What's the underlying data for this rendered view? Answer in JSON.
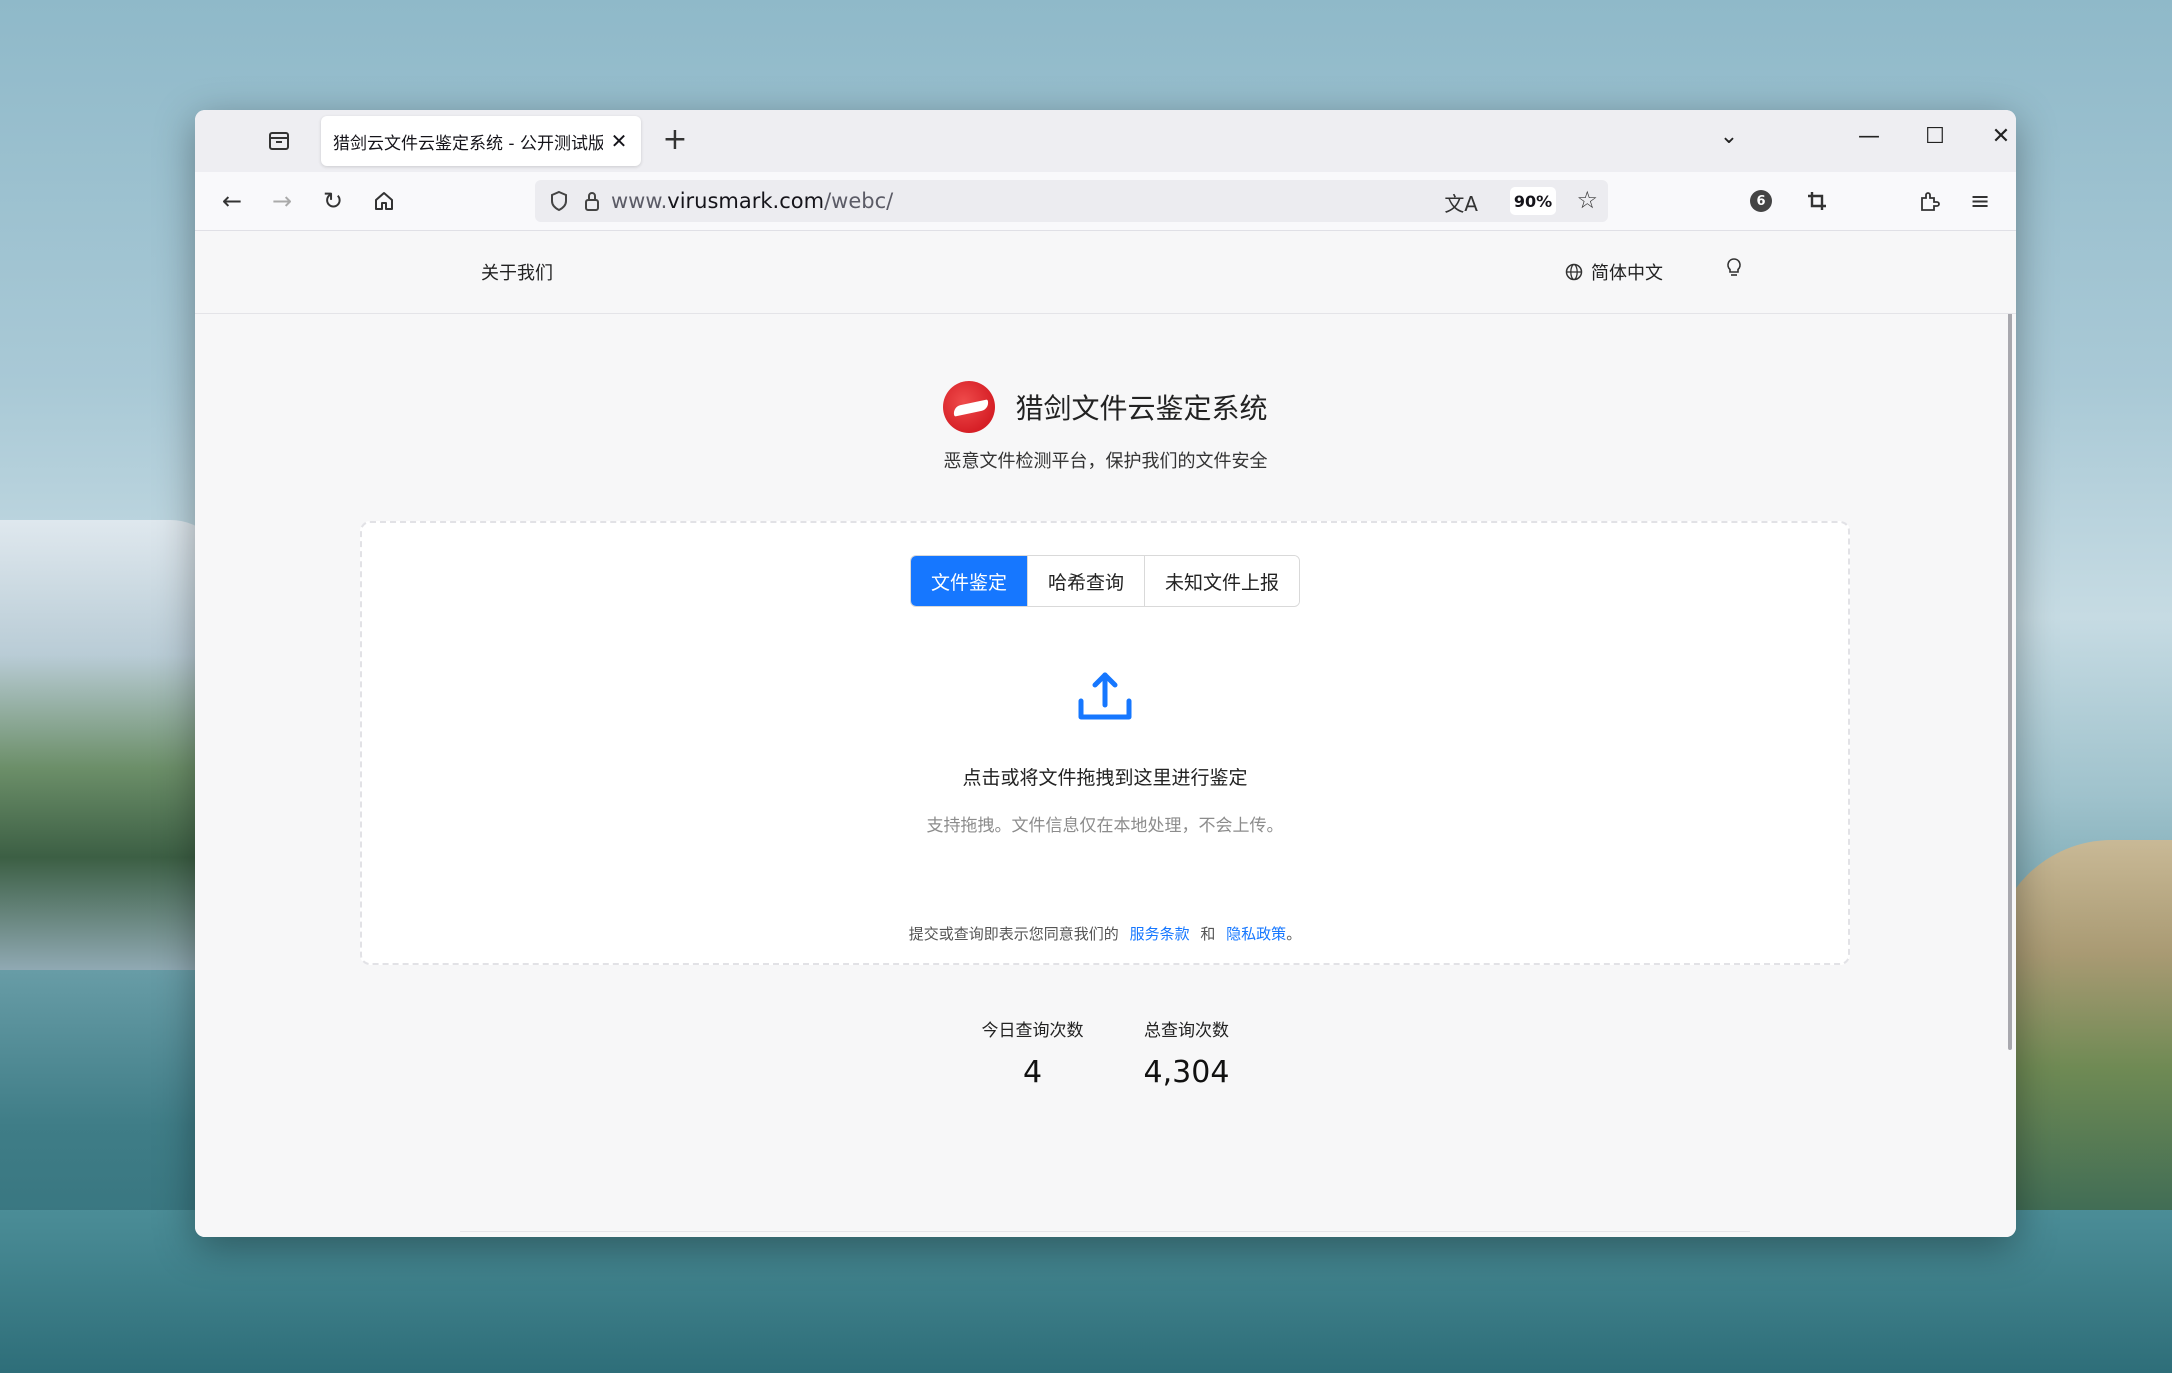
{
  "tab": {
    "title": "猎剑云文件云鉴定系统 - 公开测试版"
  },
  "urlbar": {
    "url_prefix": "www.",
    "url_domain": "virusmark.com",
    "url_path": "/webc/",
    "zoom": "90%"
  },
  "toolbar": {
    "extension_badge": "6"
  },
  "header": {
    "about": "关于我们",
    "language": "简体中文"
  },
  "brand": {
    "title": "猎剑文件云鉴定系统",
    "subtitle": "恶意文件检测平台，保护我们的文件安全"
  },
  "tabs": [
    {
      "label": "文件鉴定",
      "active": true
    },
    {
      "label": "哈希查询",
      "active": false
    },
    {
      "label": "未知文件上报",
      "active": false
    }
  ],
  "upload": {
    "main_text": "点击或将文件拖拽到这里进行鉴定",
    "hint_text": "支持拖拽。文件信息仅在本地处理，不会上传。"
  },
  "terms": {
    "prefix": "提交或查询即表示您同意我们的",
    "service_link": "服务条款",
    "and": "和",
    "privacy_link": "隐私政策",
    "suffix": "。"
  },
  "stats": {
    "today_label": "今日查询次数",
    "today_value": "4",
    "total_label": "总查询次数",
    "total_value": "4,304"
  },
  "colors": {
    "accent": "#1677ff",
    "logo_red": "#d61f26"
  }
}
